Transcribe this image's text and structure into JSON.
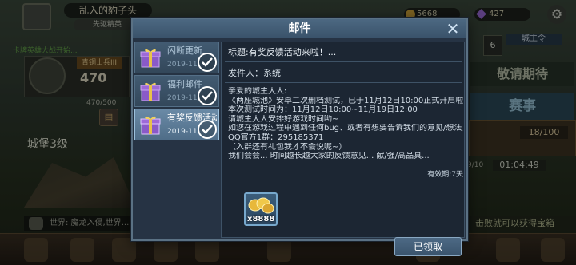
{
  "background": {
    "player_name": "乱入的豹子头",
    "player_title": "先驱精英",
    "gold": "5668",
    "gems": "427",
    "battle_banner": "卡牌英雄大战开始...",
    "rank_label": "青铜士兵III",
    "rank_value": "470",
    "progress": "470/500",
    "castle_level": "城堡3级",
    "right_level": "6",
    "lord_order": "城主令",
    "stay_tuned": "敬请期待",
    "event_title": "赛事",
    "event_count": "18/100",
    "event_date": "9/10",
    "event_timer": "01:04:49",
    "chat_text": "世界: 魔龙入侵,世界...",
    "kill_tip": "击败就可以获得宝箱"
  },
  "dialog": {
    "title": "邮件",
    "close_glyph": "✕"
  },
  "mail_list": [
    {
      "name": "闪断更新",
      "date": "2019-11-",
      "read": true,
      "active": false
    },
    {
      "name": "福利邮件",
      "date": "2019-11-",
      "read": true,
      "active": false
    },
    {
      "name": "有奖反馈活动",
      "date": "2019-11-",
      "read": true,
      "active": true
    }
  ],
  "mail": {
    "subject": "标题:有奖反馈活动来啦！...",
    "sender": "发件人：系统",
    "body": [
      "亲爱的城主大人:",
      "《两座城池》安卓二次删档测试，已于11月12日10:00正式开启啦！",
      "本次测试时间为：11月12日10:00~11月19日12:00",
      "请城主大人安排好游戏时间哟~",
      "如您在游戏过程中遇到任何bug、或者有想要告诉我们的意见/想法，欢迎入群参与有奖反馈！",
      "QQ官方1群：295185371",
      "（入群还有礼包我才不会说呢~）",
      "我们会会... 时间越长越大家的反馈意见... 献/强/高品具..."
    ],
    "validity": "有效期:7天",
    "reward_qty": "x8888",
    "claim_label": "已领取"
  },
  "colors": {
    "dialog_bg": "#263344",
    "header": "#4c6882",
    "active_item": "#6a8aa6",
    "gift_purple": "#8a5ac8",
    "gift_gold": "#e8c24a"
  }
}
